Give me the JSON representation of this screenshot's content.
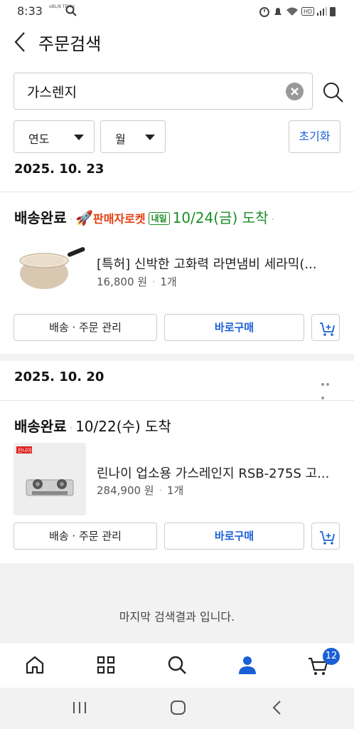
{
  "status_bar": {
    "time": "8:33",
    "tiny_label": "eBL/8 TEMU"
  },
  "header": {
    "title": "주문검색"
  },
  "search": {
    "value": "가스렌지"
  },
  "filters": {
    "year_label": "연도",
    "month_label": "월",
    "reset_label": "초기화"
  },
  "orders": [
    {
      "date": "2025. 10. 23",
      "status": "배송완료",
      "rocket_label": "판매자로켓",
      "naeil_label": "내일",
      "arrival": "10/24(금) 도착",
      "product_name": "[특허] 신박한 고화력 라면냄비 세라믹(...",
      "price": "16,800 원",
      "qty": "1개",
      "manage_label": "배송 · 주문 관리",
      "buy_label": "바로구매"
    },
    {
      "date": "2025. 10. 20",
      "status": "배송완료",
      "arrival": "10/22(수) 도착",
      "product_name": "린나이 업소용 가스레인지 RSB-275S 고...",
      "product_brand": "린나이",
      "price": "284,900 원",
      "qty": "1개",
      "manage_label": "배송 · 주문 관리",
      "buy_label": "바로구매"
    }
  ],
  "end_message": "마지막 검색결과 입니다.",
  "bottom_nav": {
    "items": [
      "home-icon",
      "category-grid-icon",
      "search-icon",
      "my-account-icon",
      "cart-icon"
    ],
    "cart_badge": "12",
    "active_color": "#1a5fd6"
  }
}
